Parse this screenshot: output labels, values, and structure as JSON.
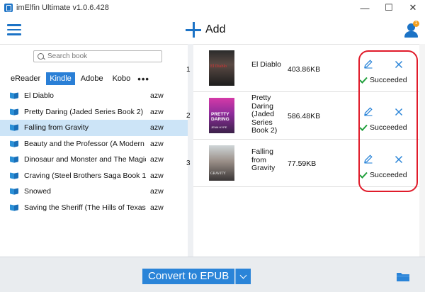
{
  "window": {
    "title": "imElfin Ultimate v1.0.6.428",
    "minimize_glyph": "—",
    "maximize_glyph": "☐",
    "close_glyph": "✕"
  },
  "toolbar": {
    "add_label": "Add",
    "user_badge": "1"
  },
  "left": {
    "search_placeholder": "Search book",
    "tabs": [
      {
        "label": "eReader",
        "active": false
      },
      {
        "label": "Kindle",
        "active": true
      },
      {
        "label": "Adobe",
        "active": false
      },
      {
        "label": "Kobo",
        "active": false
      }
    ],
    "more_label": "•••",
    "books": [
      {
        "title": "El Diablo",
        "format": "azw",
        "selected": false
      },
      {
        "title": "Pretty Daring (Jaded Series Book 2)",
        "format": "azw",
        "selected": false
      },
      {
        "title": "Falling from Gravity",
        "format": "azw",
        "selected": true
      },
      {
        "title": "Beauty and the Professor (A Modern F...",
        "format": "azw",
        "selected": false
      },
      {
        "title": "Dinosaur and Monster and The Magic ...",
        "format": "azw",
        "selected": false
      },
      {
        "title": "Craving (Steel Brothers Saga Book 1)",
        "format": "azw",
        "selected": false
      },
      {
        "title": "Snowed",
        "format": "azw",
        "selected": false
      },
      {
        "title": "Saving the Sheriff (The Hills of Texas B...",
        "format": "azw",
        "selected": false
      }
    ]
  },
  "conversions": [
    {
      "index": "1",
      "name": "El Diablo",
      "size": "403.86KB",
      "status": "Succeeded",
      "cover_text": "El Diablo",
      "cover_author": ""
    },
    {
      "index": "2",
      "name": "Pretty Daring (Jaded Series Book 2)",
      "size": "586.48KB",
      "status": "Succeeded",
      "cover_text": "PRETTY DARING",
      "cover_author": "JENN HYPE"
    },
    {
      "index": "3",
      "name": "Falling from Gravity",
      "size": "77.59KB",
      "status": "Succeeded",
      "cover_text": "GRAVITY",
      "cover_author": ""
    }
  ],
  "bottom": {
    "convert_label": "Convert to EPUB"
  },
  "colors": {
    "accent": "#2a84d8",
    "highlight": "#e01b2a",
    "success": "#1e9e3a",
    "selected_row": "#cce4f7"
  }
}
